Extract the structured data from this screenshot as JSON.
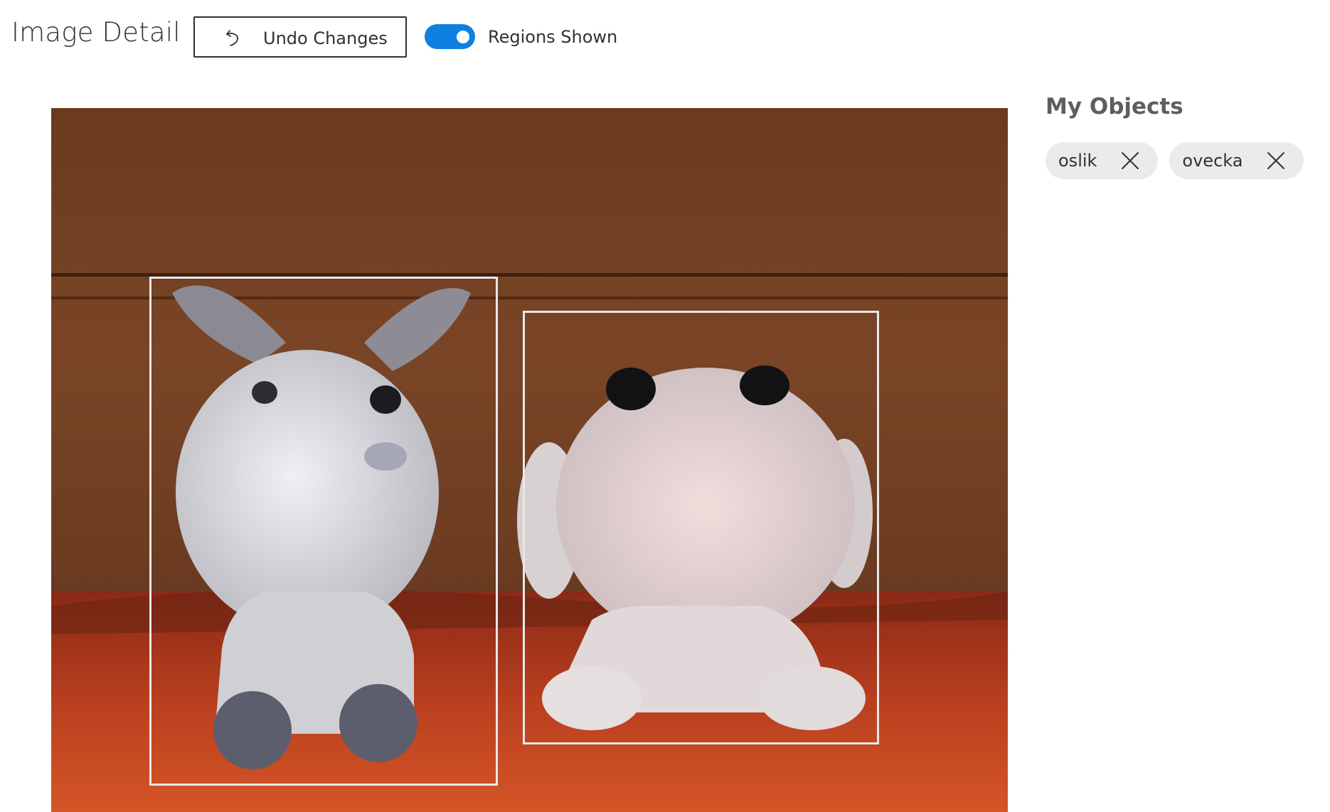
{
  "header": {
    "title": "Image Detail",
    "undo_label": "Undo Changes",
    "toggle": {
      "label": "Regions Shown",
      "on": true,
      "color": "#0f7fe0"
    }
  },
  "image": {
    "regions": [
      {
        "label": "oslik"
      },
      {
        "label": "ovecka"
      }
    ]
  },
  "side_panel": {
    "title": "My Objects",
    "tags": [
      {
        "label": "oslik",
        "icon": "close-icon"
      },
      {
        "label": "ovecka",
        "icon": "close-icon"
      }
    ]
  },
  "icons": {
    "undo": "undo-icon",
    "close": "close-icon"
  }
}
